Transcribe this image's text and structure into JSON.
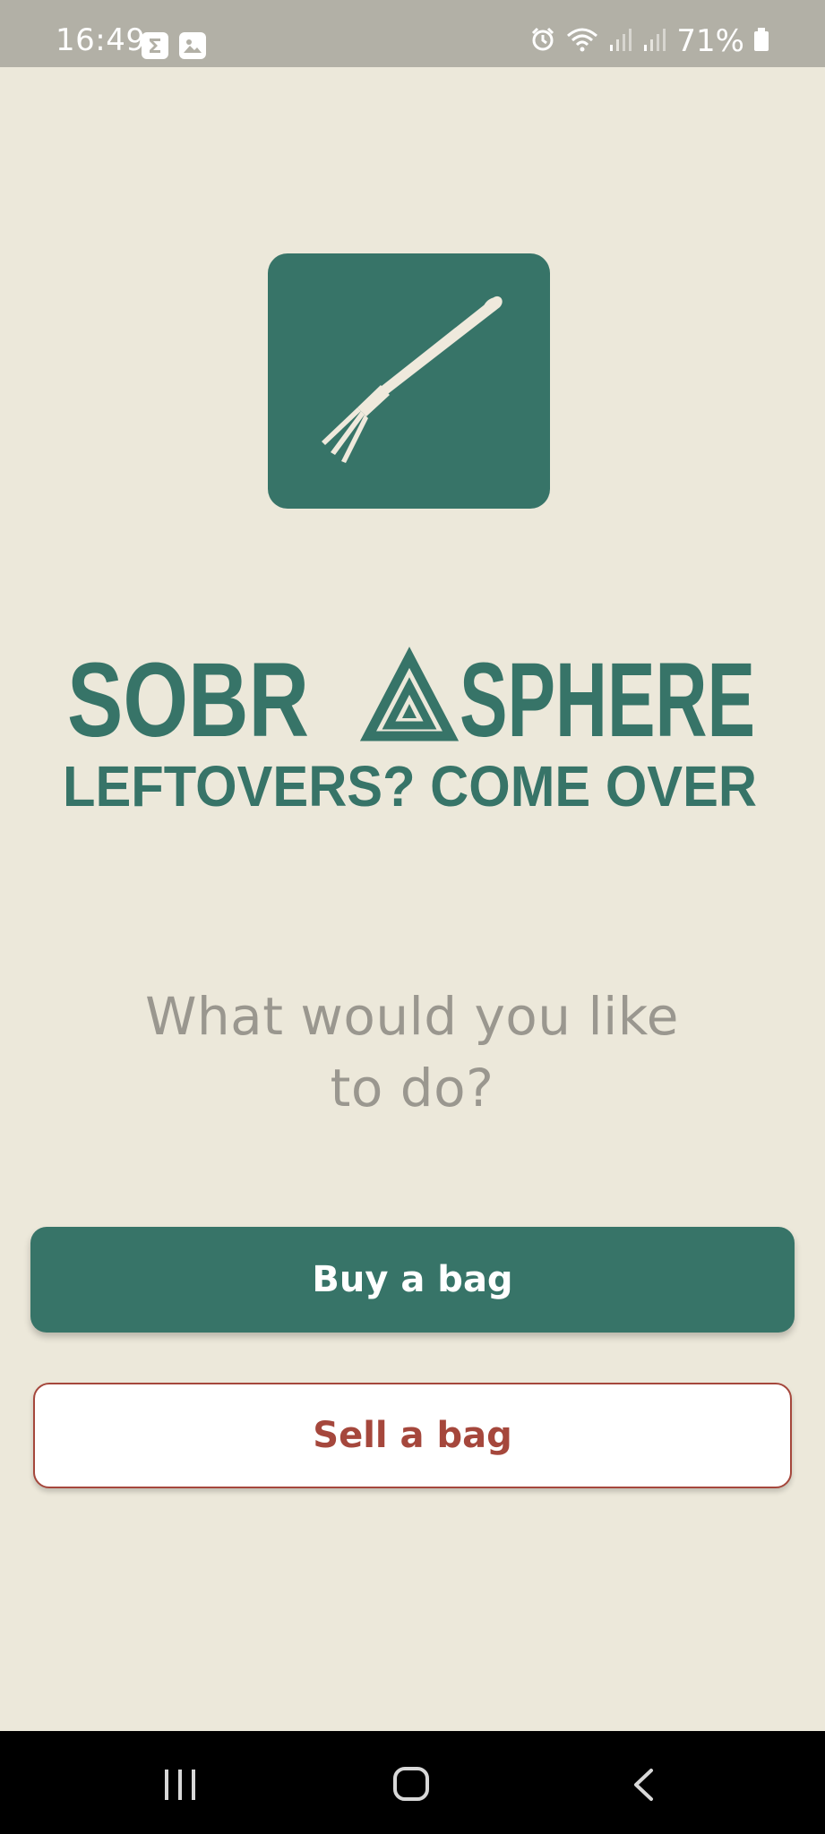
{
  "status_bar": {
    "time": "16:49",
    "battery": "71%",
    "icons": [
      "sigma-notification-icon",
      "gallery-notification-icon",
      "alarm-icon",
      "wifi-icon",
      "signal-icon",
      "signal-icon",
      "battery-icon"
    ]
  },
  "logo": {
    "icon": "fork-icon",
    "brand_part1": "SOBR",
    "brand_part2": "SPHERE",
    "tagline": "LEFTOVERS? COME OVER"
  },
  "prompt": {
    "line1": "What would you like",
    "line2": "to do?"
  },
  "actions": {
    "buy_label": "Buy a bag",
    "sell_label": "Sell a bag"
  },
  "nav": {
    "icons": [
      "recent-apps-icon",
      "home-icon",
      "back-icon"
    ]
  },
  "colors": {
    "background": "#ece8da",
    "brand_green": "#377468",
    "accent_red": "#a5473c",
    "status_bar": "#b2b0a6",
    "question_text": "#9a978f"
  }
}
